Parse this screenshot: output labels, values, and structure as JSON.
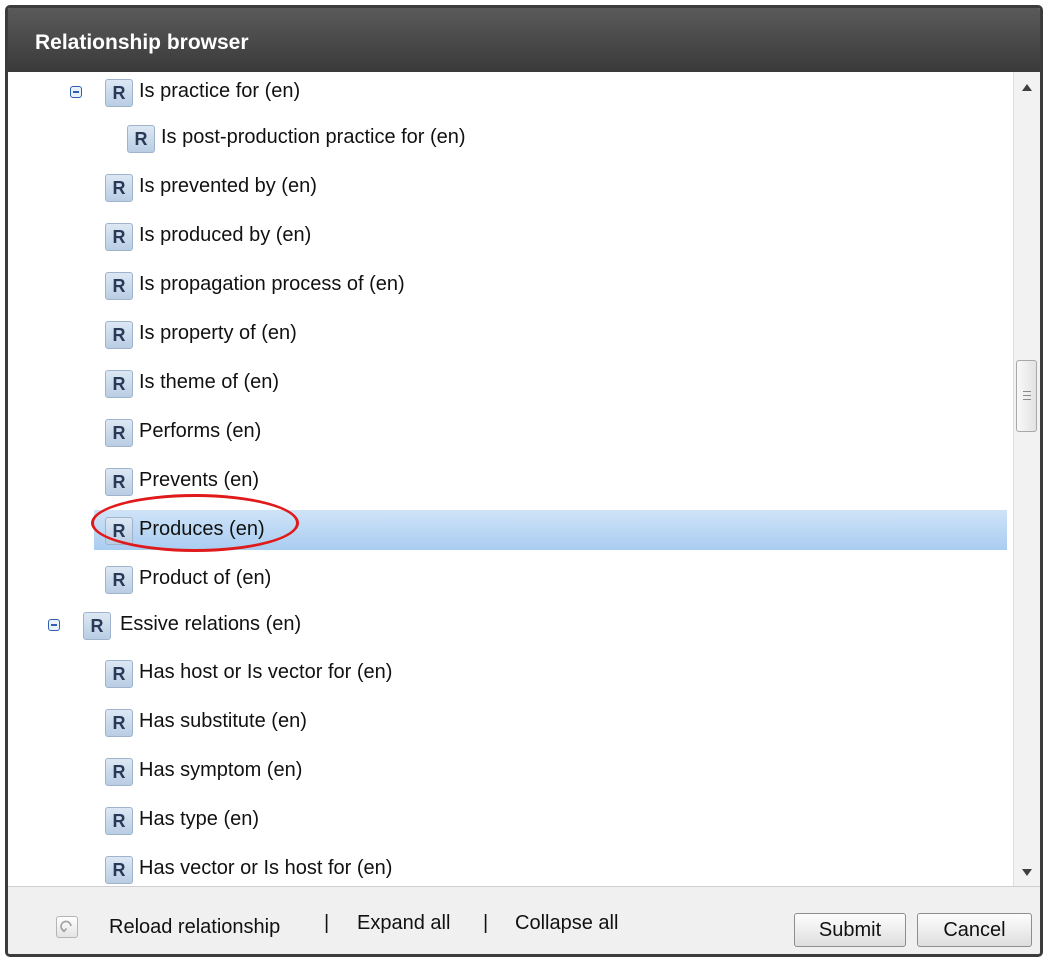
{
  "dialog": {
    "title": "Relationship browser"
  },
  "tree": {
    "items": [
      {
        "label": "Is practice for (en)",
        "expanded": true,
        "selected": false
      },
      {
        "label": "Is post-production practice for (en)",
        "selected": false
      },
      {
        "label": "Is prevented by (en)",
        "selected": false
      },
      {
        "label": "Is produced by (en)",
        "selected": false
      },
      {
        "label": "Is propagation process of (en)",
        "selected": false
      },
      {
        "label": "Is property of (en)",
        "selected": false
      },
      {
        "label": "Is theme of (en)",
        "selected": false
      },
      {
        "label": "Performs (en)",
        "selected": false
      },
      {
        "label": "Prevents (en)",
        "selected": false
      },
      {
        "label": "Produces (en)",
        "selected": true
      },
      {
        "label": "Product of (en)",
        "selected": false
      },
      {
        "label": "Essive relations (en)",
        "expanded": true,
        "selected": false
      },
      {
        "label": "Has host or Is vector for (en)",
        "selected": false
      },
      {
        "label": "Has substitute (en)",
        "selected": false
      },
      {
        "label": "Has symptom (en)",
        "selected": false
      },
      {
        "label": "Has type (en)",
        "selected": false
      },
      {
        "label": "Has vector or Is host for (en)",
        "selected": false
      }
    ],
    "badge_letter": "R"
  },
  "footer": {
    "reload_label": "Reload relationship",
    "expand_label": "Expand all",
    "collapse_label": "Collapse all",
    "separator": "|",
    "submit_label": "Submit",
    "cancel_label": "Cancel"
  },
  "icons": {
    "toggle": "minus-square-icon",
    "badge": "relationship-r-icon",
    "reload": "reload-icon",
    "scroll_up": "arrow-up-icon",
    "scroll_down": "arrow-down-icon"
  },
  "colors": {
    "titlebar": "#444444",
    "selection": "#b9d7f4",
    "annotation_circle": "#e01a1a"
  }
}
